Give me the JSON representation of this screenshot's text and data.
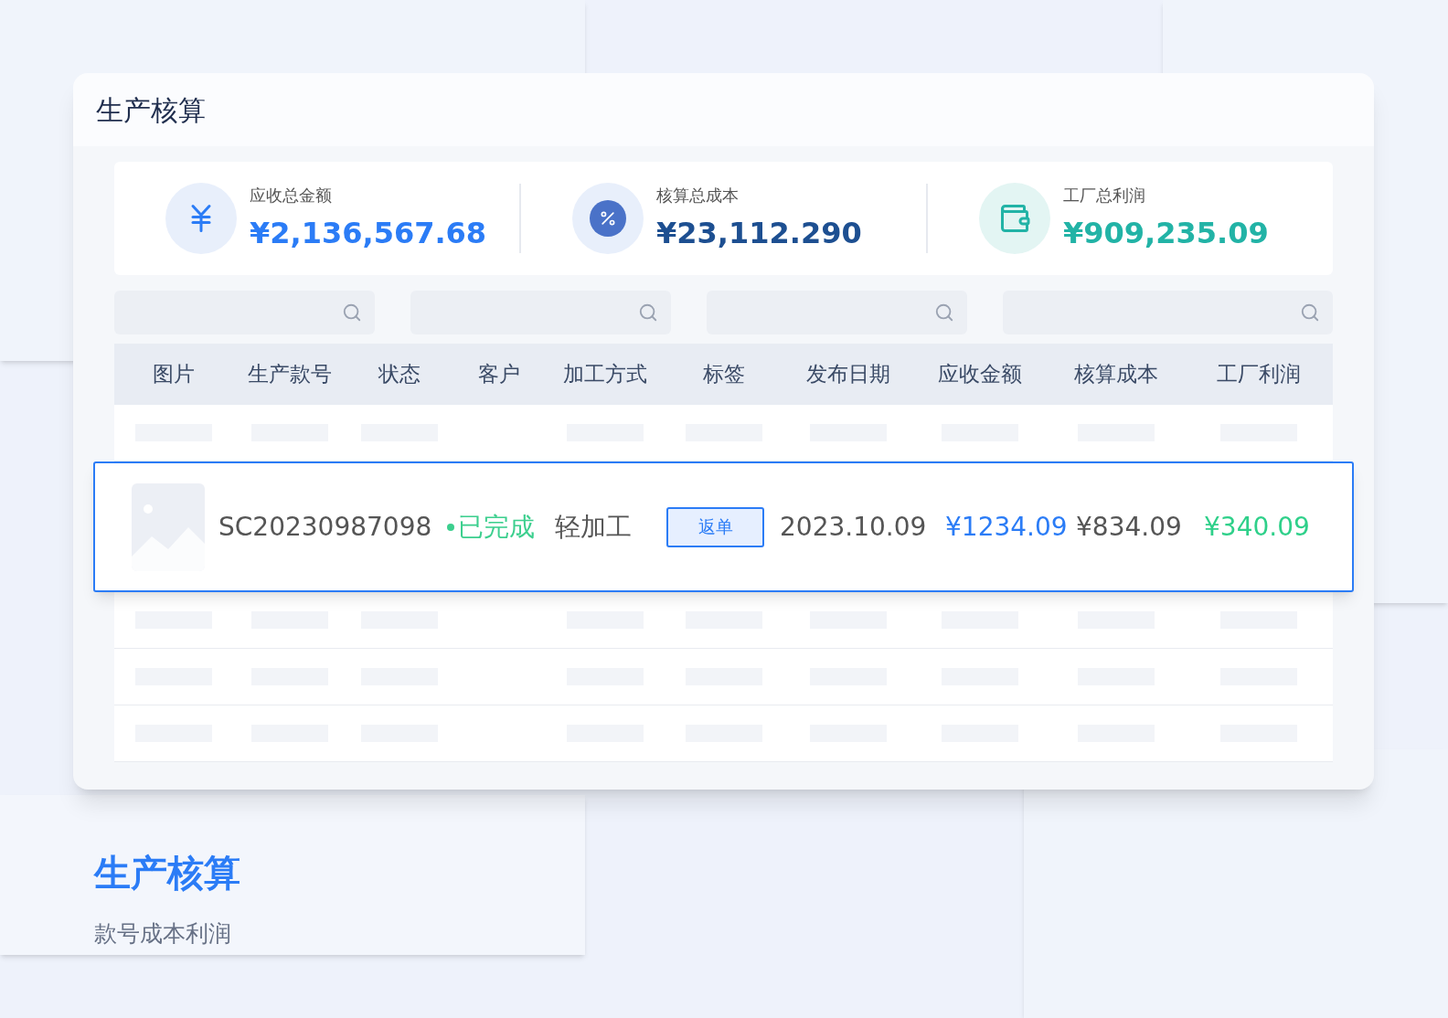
{
  "panel": {
    "title": "生产核算"
  },
  "stats": [
    {
      "kind": "receivable",
      "label": "应收总金额",
      "value": "¥2,136,567.68",
      "color": "#2b7cf6"
    },
    {
      "kind": "cost",
      "label": "核算总成本",
      "value": "¥23,112.290",
      "color": "#1d4f91"
    },
    {
      "kind": "profit",
      "label": "工厂总利润",
      "value": "¥909,235.09",
      "color": "#22b3a6"
    }
  ],
  "search_fields": [
    {
      "kind": "search"
    },
    {
      "kind": "search"
    },
    {
      "kind": "search"
    },
    {
      "kind": "search"
    }
  ],
  "table": {
    "columns": [
      "图片",
      "生产款号",
      "状态",
      "客户",
      "加工方式",
      "标签",
      "发布日期",
      "应收金额",
      "核算成本",
      "工厂利润"
    ],
    "rows": [
      {
        "kind": "skeleton"
      },
      {
        "kind": "detail",
        "code": "SC20230987098",
        "status": "已完成",
        "process": "轻加工",
        "tag": "返单",
        "date": "2023.10.09",
        "receivable": "¥1234.09",
        "cost": "¥834.09",
        "profit": "¥340.09"
      },
      {
        "kind": "skeleton"
      },
      {
        "kind": "skeleton"
      },
      {
        "kind": "skeleton"
      }
    ]
  },
  "caption": {
    "title": "生产核算",
    "subtitle": "款号成本利润"
  }
}
